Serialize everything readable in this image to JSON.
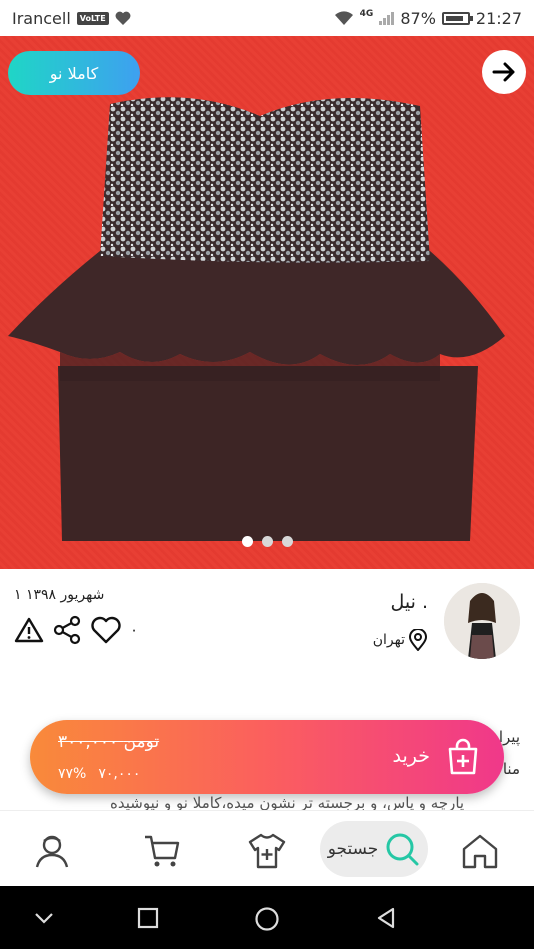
{
  "status_bar": {
    "carrier": "Irancell",
    "volte": "VoLTE",
    "network": "4G",
    "battery": "87%",
    "time": "21:27"
  },
  "product": {
    "badge": "کاملا نو",
    "image_count": 3,
    "active_image_index": 0
  },
  "seller": {
    "name": "نیل .",
    "location": "تهران"
  },
  "post": {
    "date": "۱ شهریور ۱۳۹۸",
    "likes": "۰"
  },
  "description": {
    "line1": "پیرا",
    "line2": "منا",
    "line3": "پارچه و پاس، و برجسته تر نشون میده،کاملا نو و نپوشیده"
  },
  "buy_bar": {
    "old_price": "۳۰۰,۰۰۰ تومن",
    "discount": "۷۷%",
    "new_price": "۷۰,۰۰۰",
    "buy_label": "خرید"
  },
  "bottom_nav": {
    "search_label": "جستجو"
  },
  "colors": {
    "badge_gradient": [
      "#1fd6c6",
      "#3ea0f0"
    ],
    "buy_gradient": [
      "#f98a3a",
      "#fb5f5e",
      "#f0388a"
    ],
    "search_icon": "#25c7a5"
  }
}
